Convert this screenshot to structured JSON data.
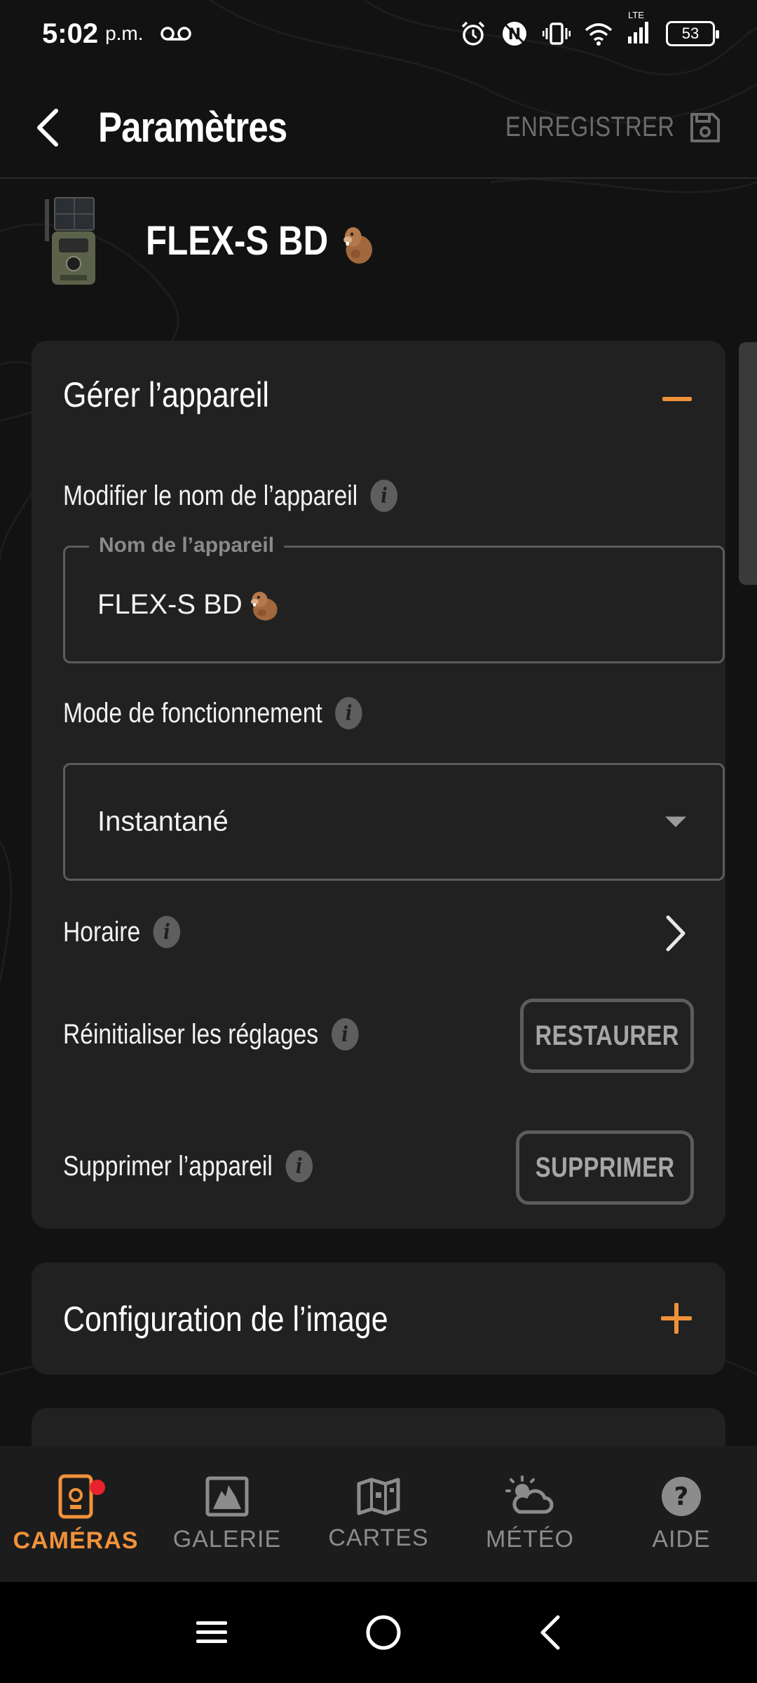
{
  "status_bar": {
    "time": "5:02",
    "ampm": "p.m.",
    "network_type": "LTE",
    "battery_level": "53"
  },
  "app_bar": {
    "title": "Paramètres",
    "save_label": "ENREGISTRER"
  },
  "device": {
    "name": "FLEX-S BD"
  },
  "manage_section": {
    "title": "Gérer l’appareil",
    "rename_label": "Modifier le nom de l’appareil",
    "name_field_legend": "Nom de l’appareil",
    "name_field_value": "FLEX-S BD",
    "mode_label": "Mode de fonctionnement",
    "mode_value": "Instantané",
    "schedule_label": "Horaire",
    "reset_label": "Réinitialiser les réglages",
    "reset_button": "RESTAURER",
    "delete_label": "Supprimer l’appareil",
    "delete_button": "SUPPRIMER"
  },
  "image_section": {
    "title": "Configuration de l’image"
  },
  "bottom_nav": {
    "items": [
      {
        "label": "CAMÉRAS",
        "icon": "camera-icon",
        "active": true
      },
      {
        "label": "GALERIE",
        "icon": "gallery-icon",
        "active": false
      },
      {
        "label": "CARTES",
        "icon": "map-icon",
        "active": false
      },
      {
        "label": "MÉTÉO",
        "icon": "weather-icon",
        "active": false
      },
      {
        "label": "AIDE",
        "icon": "help-icon",
        "active": false
      }
    ]
  },
  "colors": {
    "accent": "#F0913A",
    "background": "#121212",
    "card": "#212121",
    "badge": "#E8232D"
  }
}
